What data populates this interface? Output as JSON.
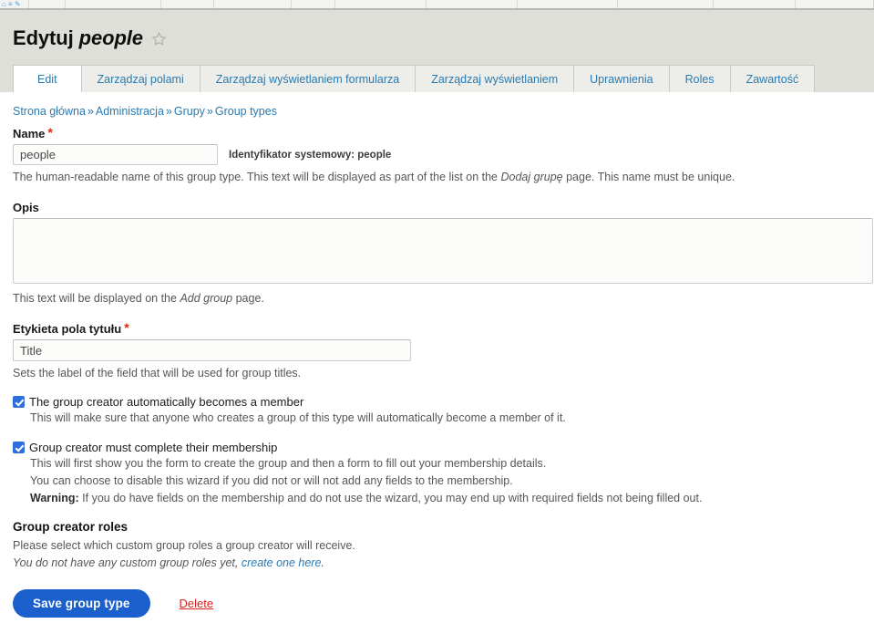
{
  "toolbar": {
    "home_icon": "home-icon"
  },
  "header": {
    "title_prefix": "Edytuj",
    "title_entity": "people",
    "bookmark_icon": "star-outline-icon"
  },
  "tabs": [
    {
      "label": "Edit",
      "active": true
    },
    {
      "label": "Zarządzaj polami",
      "active": false
    },
    {
      "label": "Zarządzaj wyświetlaniem formularza",
      "active": false
    },
    {
      "label": "Zarządzaj wyświetlaniem",
      "active": false
    },
    {
      "label": "Uprawnienia",
      "active": false
    },
    {
      "label": "Roles",
      "active": false
    },
    {
      "label": "Zawartość",
      "active": false
    }
  ],
  "breadcrumb": {
    "separator": "»",
    "items": [
      {
        "label": "Strona główna"
      },
      {
        "label": "Administracja"
      },
      {
        "label": "Grupy"
      },
      {
        "label": "Group types"
      }
    ]
  },
  "form": {
    "name": {
      "label": "Name",
      "required_marker": "*",
      "value": "people",
      "machine_name_prefix": "Identyfikator systemowy:",
      "machine_name_value": "people",
      "description_part1": "The human-readable name of this group type. This text will be displayed as part of the list on the ",
      "description_em": "Dodaj grupę",
      "description_part2": " page. This name must be unique."
    },
    "description": {
      "label": "Opis",
      "value": "",
      "help_part1": "This text will be displayed on the ",
      "help_em": "Add group",
      "help_part2": " page."
    },
    "title_label": {
      "label": "Etykieta pola tytułu",
      "required_marker": "*",
      "value": "Title",
      "description": "Sets the label of the field that will be used for group titles."
    },
    "creator_membership": {
      "checked": true,
      "label": "The group creator automatically becomes a member",
      "description": "This will make sure that anyone who creates a group of this type will automatically become a member of it."
    },
    "creator_wizard": {
      "checked": true,
      "label": "Group creator must complete their membership",
      "description_line1": "This will first show you the form to create the group and then a form to fill out your membership details.",
      "description_line2": "You can choose to disable this wizard if you did not or will not add any fields to the membership.",
      "warning_label": "Warning:",
      "warning_text": " If you do have fields on the membership and do not use the wizard, you may end up with required fields not being filled out."
    },
    "creator_roles": {
      "title": "Group creator roles",
      "description": "Please select which custom group roles a group creator will receive.",
      "empty_prefix": "You do not have any custom group roles yet, ",
      "empty_link": "create one here",
      "empty_suffix": "."
    }
  },
  "actions": {
    "save_label": "Save group type",
    "delete_label": "Delete"
  },
  "colors": {
    "accent_link": "#2a7ab0",
    "primary_button": "#1a5fcc",
    "delete_link": "#d72222",
    "required_marker": "#e32700",
    "header_band": "#dfdfd9",
    "checkbox_checked": "#2f6fdd"
  }
}
